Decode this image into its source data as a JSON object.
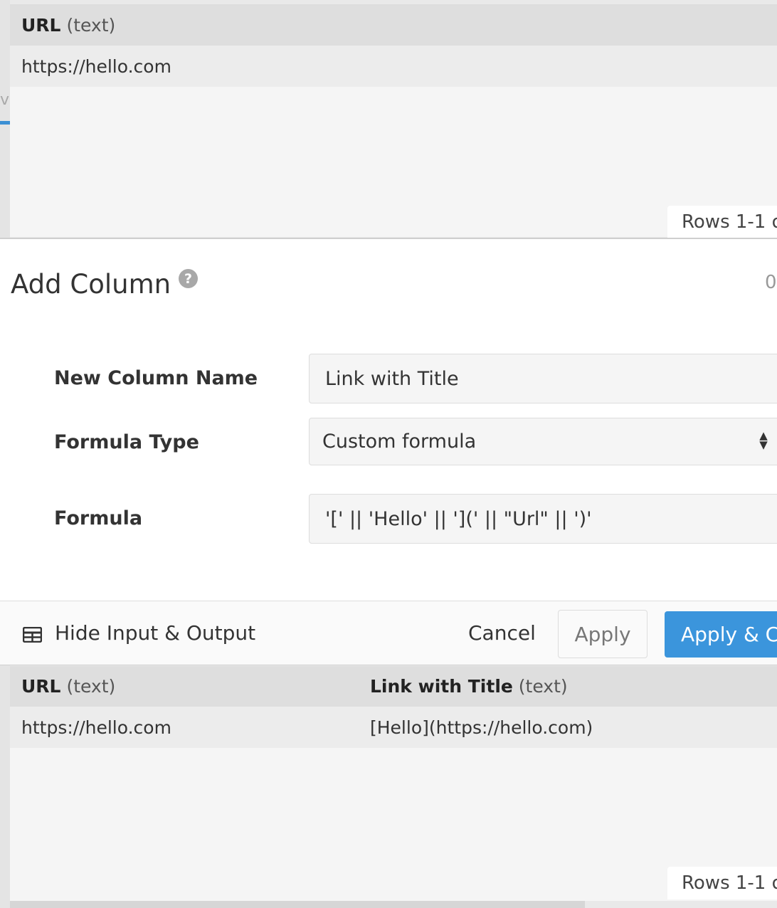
{
  "input_grid": {
    "columns": [
      {
        "name": "URL",
        "type": "(text)"
      }
    ],
    "rows": [
      [
        "https://hello.com"
      ]
    ],
    "rows_count": "Rows 1-1 o"
  },
  "sidebar": {
    "letter": "v"
  },
  "dialog": {
    "title": "Add Column",
    "help_symbol": "?",
    "right_number": "0",
    "fields": {
      "new_column_name": {
        "label": "New Column Name",
        "value": "Link with Title"
      },
      "formula_type": {
        "label": "Formula Type",
        "value": "Custom formula"
      },
      "formula": {
        "label": "Formula",
        "value": "'[' || 'Hello' || '](' || \"Url\" || ')'"
      }
    }
  },
  "footer": {
    "hide_io_label": "Hide Input & Output",
    "cancel_label": "Cancel",
    "apply_label": "Apply",
    "apply_close_label": "Apply & Cl"
  },
  "output_grid": {
    "columns": [
      {
        "name": "URL",
        "type": "(text)"
      },
      {
        "name": "Link with Title",
        "type": "(text)"
      }
    ],
    "rows": [
      [
        "https://hello.com",
        "[Hello](https://hello.com)"
      ]
    ],
    "rows_count": "Rows 1-1 o"
  },
  "colors": {
    "accent": "#3b95dc",
    "header_bg": "#dedede",
    "row_bg": "#ececec"
  },
  "icons": {
    "help": "help-icon",
    "table": "table-icon",
    "select_arrows": "select-arrows-icon"
  }
}
